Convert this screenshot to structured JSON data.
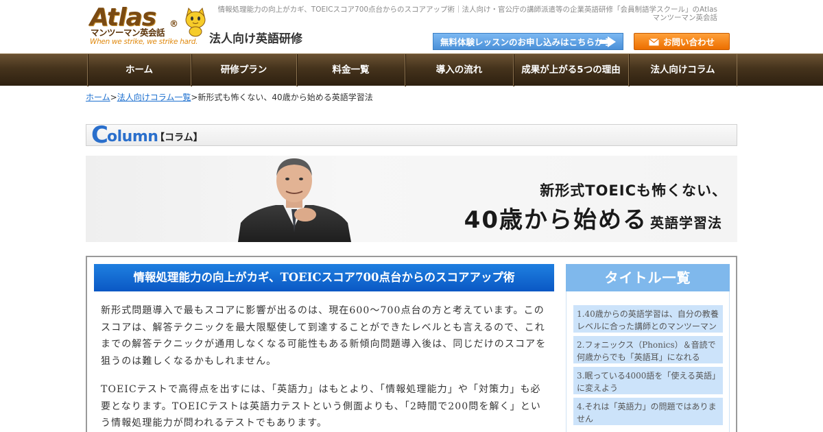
{
  "header": {
    "logo_text": "Atlas",
    "logo_reg": "®",
    "logo_sub": "マンツーマン英会話",
    "logo_tagline": "When we strike, we strike hard.",
    "subtitle": "法人向け英語研修",
    "description": "情報処理能力の向上がカギ、TOEICスコア700点台からのスコアアップ術｜法人向け・官公庁の講師派遣等の企業英語研修「会員制語学スクール」のAtlasマンツーマン英会話",
    "trial_button": "無料体験レッスンのお申し込みはこちらから",
    "contact_button": "お問い合わせ"
  },
  "nav": {
    "items": [
      {
        "label": "ホーム"
      },
      {
        "label": "研修プラン"
      },
      {
        "label": "料金一覧"
      },
      {
        "label": "導入の流れ"
      },
      {
        "label": "成果が上がる5つの理由"
      },
      {
        "label": "法人向けコラム"
      }
    ]
  },
  "breadcrumb": {
    "home": "ホーム",
    "sep1": ">",
    "column_list": "法人向けコラム一覧",
    "sep2": ">",
    "current": "新形式も怖くない、40歳から始める英語学習法"
  },
  "column_header": {
    "big_letter": "C",
    "rest": "olumn",
    "jp": "【コラム】"
  },
  "banner": {
    "line1": "新形式TOEICも怖くない、",
    "line2_big": "40歳から始める",
    "line2_small": "英語学習法"
  },
  "article": {
    "title": "情報処理能力の向上がカギ、TOEICスコア700点台からのスコアアップ術",
    "paragraph1": "新形式問題導入で最もスコアに影響が出るのは、現在600～700点台の方と考えています。このスコアは、解答テクニックを最大限駆使して到達することができたレベルとも言えるので、これまでの解答テクニックが通用しなくなる可能性もある新傾向問題導入後は、同じだけのスコアを狙うのは難しくなるかもしれません。",
    "paragraph2": "TOEICテストで高得点を出すには、「英語力」はもとより、「情報処理能力」や「対策力」も必要となります。TOEICテストは英語力テストという側面よりも、「2時間で200問を解く」という情報処理能力が問われるテストでもあります。"
  },
  "sidebar": {
    "title": "タイトル一覧",
    "items": [
      {
        "label": "1.40歳からの英語学習は、自分の教養レベルに合った講師とのマンツーマン"
      },
      {
        "label": "2.フォニックス（Phonics）＆音読で何歳からでも「英語耳」になれる"
      },
      {
        "label": "3.眠っている4000語を「使える英語」に変えよう"
      },
      {
        "label": "4.それは「英語力」の問題ではありません"
      }
    ]
  },
  "colors": {
    "brand_brown": "#45331c",
    "accent_blue": "#0a58c4",
    "sidebar_blue": "#7fb8ec",
    "orange": "#ec6f00"
  }
}
